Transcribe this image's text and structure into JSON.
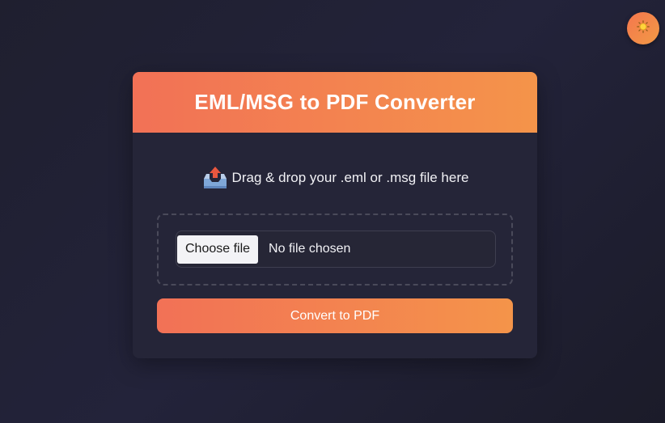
{
  "theme_toggle": {
    "icon": "sun-icon",
    "accent": "#f4894a"
  },
  "header": {
    "title": "EML/MSG to PDF Converter"
  },
  "upload": {
    "icon": "outbox-tray-icon",
    "instruction": "Drag & drop your .eml or .msg file here",
    "choose_label": "Choose file",
    "status": "No file chosen"
  },
  "actions": {
    "convert_label": "Convert to PDF"
  },
  "colors": {
    "accent_start": "#f27156",
    "accent_end": "#f4944a",
    "card_bg": "#252538",
    "page_bg": "#20202f"
  }
}
